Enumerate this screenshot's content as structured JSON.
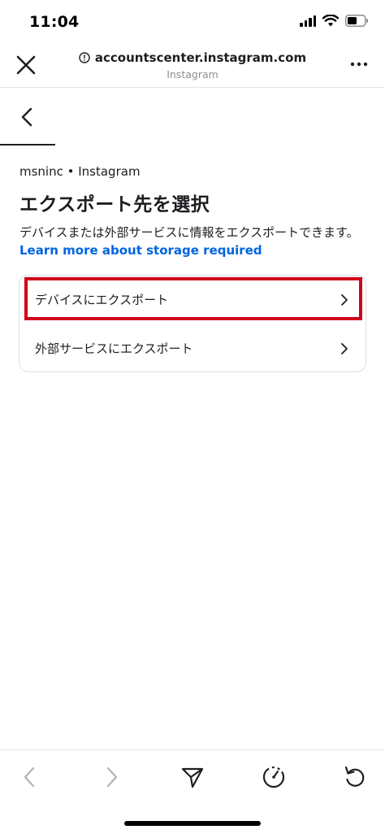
{
  "status_bar": {
    "time": "11:04",
    "icons": [
      "signal-icon",
      "wifi-icon",
      "battery-icon"
    ]
  },
  "browser": {
    "url": "accountscenter.instagram.com",
    "site_name": "Instagram",
    "icons": [
      "close-icon",
      "info-circle-icon",
      "more-icon"
    ]
  },
  "page": {
    "account": "msninc • Instagram",
    "title": "エクスポート先を選択",
    "description": "デバイスまたは外部サービスに情報をエクスポートできます。",
    "learn_more": "Learn more about storage required",
    "options": [
      {
        "label": "デバイスにエクスポート",
        "highlighted": true
      },
      {
        "label": "外部サービスにエクスポート",
        "highlighted": false
      }
    ],
    "highlight_color": "#d0021b",
    "link_color": "#0064e0"
  },
  "toolbar": {
    "icons": [
      "back-arrow-icon",
      "forward-arrow-icon",
      "share-icon",
      "speed-icon",
      "reload-icon"
    ]
  }
}
